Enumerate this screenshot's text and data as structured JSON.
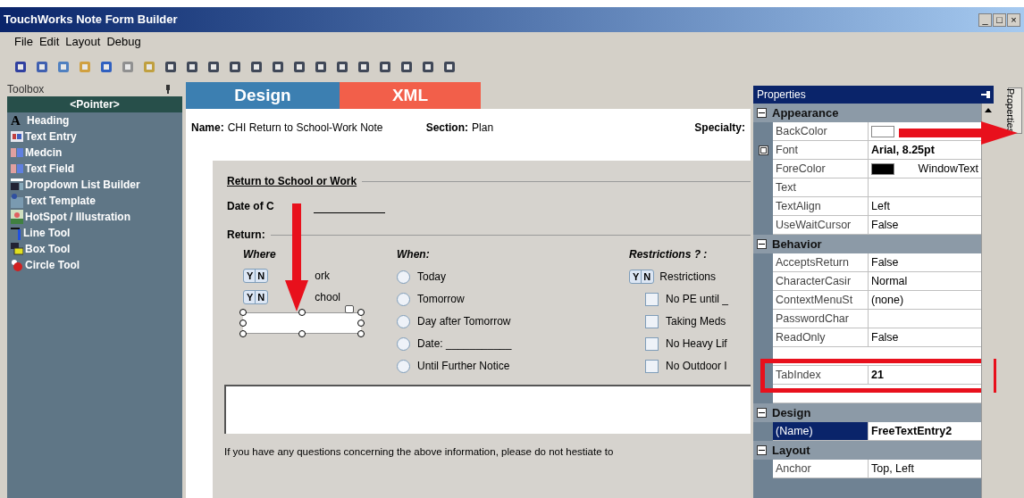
{
  "window": {
    "title": "TouchWorks Note Form Builder",
    "controls": [
      "_",
      "□",
      "×"
    ]
  },
  "menu": [
    "File",
    "Edit",
    "Layout",
    "Debug"
  ],
  "toolbox": {
    "title": "Toolbox",
    "items": [
      {
        "label": "<Pointer>",
        "selected": true,
        "kind": "pointer"
      },
      {
        "label": "Heading",
        "selected": false,
        "kind": "letter",
        "glyph": "A"
      },
      {
        "label": "Text Entry",
        "selected": false,
        "kind": "entry"
      },
      {
        "label": "Medcin",
        "selected": false,
        "kind": "field"
      },
      {
        "label": "Text Field",
        "selected": false,
        "kind": "field"
      },
      {
        "label": "Dropdown List Builder",
        "selected": false,
        "kind": "dropdown"
      },
      {
        "label": "Text Template",
        "selected": false,
        "kind": "template"
      },
      {
        "label": "HotSpot / Illustration",
        "selected": false,
        "kind": "image"
      },
      {
        "label": "Line Tool",
        "selected": false,
        "kind": "line"
      },
      {
        "label": "Box Tool",
        "selected": false,
        "kind": "box"
      },
      {
        "label": "Circle Tool",
        "selected": false,
        "kind": "circle"
      }
    ]
  },
  "tabs": [
    {
      "label": "Design",
      "selected": true
    },
    {
      "label": "XML",
      "selected": false
    }
  ],
  "form": {
    "name_label": "Name:",
    "name_value": "CHI Return to School-Work Note",
    "section_label": "Section:",
    "section_value": "Plan",
    "specialty_label": "Specialty:",
    "heading": "Return to School or Work",
    "date_label": "Date of C",
    "return_label": "Return:",
    "where": {
      "label": "Where",
      "items": [
        {
          "yes": "Y",
          "no": "N",
          "label": "ork"
        },
        {
          "yes": "Y",
          "no": "N",
          "label": "chool"
        }
      ]
    },
    "when": {
      "label": "When:",
      "options": [
        {
          "label": "Today",
          "selected": false
        },
        {
          "label": "Tomorrow",
          "selected": false
        },
        {
          "label": "Day after Tomorrow",
          "selected": false
        },
        {
          "label": "Date: ___________",
          "selected": false
        },
        {
          "label": "Until Further Notice",
          "selected": false
        }
      ]
    },
    "restrictions": {
      "label": "Restrictions ? :",
      "yes": "Y",
      "no": "N",
      "toggle_label": "Restrictions",
      "items": [
        {
          "label": "No PE until _",
          "checked": false
        },
        {
          "label": "Taking Meds",
          "checked": false
        },
        {
          "label": "No Heavy Lif",
          "checked": false
        },
        {
          "label": "No Outdoor I",
          "checked": false
        }
      ]
    },
    "footer": "If you have any questions concerning the above information, please do not hestiate to"
  },
  "properties": {
    "title": "Properties",
    "side_tab": "Properties",
    "groups": [
      {
        "name": "Appearance",
        "expanded": true,
        "rows": [
          {
            "kind": "color",
            "name": "BackColor",
            "color": "#ffffff"
          },
          {
            "kind": "text",
            "name": "Font",
            "value": "Arial, 8.25pt",
            "bold": true,
            "expandable": true
          },
          {
            "kind": "color",
            "name": "ForeColor",
            "color": "#000000",
            "value": "WindowText"
          },
          {
            "kind": "text",
            "name": "Text"
          },
          {
            "kind": "text",
            "name": "TextAlign",
            "value": "Left"
          },
          {
            "kind": "text",
            "name": "UseWaitCursor",
            "value": "False"
          }
        ]
      },
      {
        "name": "Behavior",
        "expanded": true,
        "rows": [
          {
            "kind": "text",
            "name": "AcceptsReturn",
            "value": "False"
          },
          {
            "kind": "text",
            "name": "CharacterCasir",
            "value": "Normal"
          },
          {
            "kind": "text",
            "name": "ContextMenuSt",
            "value": "(none)"
          },
          {
            "kind": "text",
            "name": "PasswordChar"
          },
          {
            "kind": "text",
            "name": "ReadOnly",
            "value": "False"
          },
          {
            "kind": "covered"
          },
          {
            "kind": "text",
            "name": "TabIndex",
            "value": "21",
            "bold": true,
            "highlighted": true
          },
          {
            "kind": "covered"
          }
        ]
      },
      {
        "name": "Design",
        "expanded": true,
        "rows": [
          {
            "kind": "text",
            "name": "(Name)",
            "value": "FreeTextEntry2",
            "bold": true,
            "selected": true
          }
        ]
      },
      {
        "name": "Layout",
        "expanded": true,
        "rows": [
          {
            "kind": "text",
            "name": "Anchor",
            "value": "Top, Left"
          }
        ]
      }
    ]
  }
}
